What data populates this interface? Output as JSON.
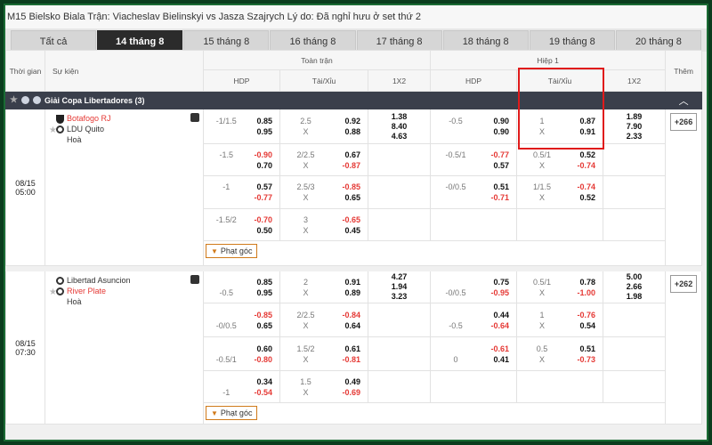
{
  "ticker": "M15 Bielsko Biala Trận: Viacheslav Bielinskyi vs Jasza Szajrych Lý do: Đã nghỉ hưu ở set thứ 2",
  "tabs": [
    "Tất cả",
    "14 tháng 8",
    "15 tháng 8",
    "16 tháng 8",
    "17 tháng 8",
    "18 tháng 8",
    "19 tháng 8",
    "20 tháng 8"
  ],
  "header": {
    "time": "Thời gian",
    "event": "Sự kiện",
    "full": "Toàn trận",
    "half": "Hiệp 1",
    "more": "Thêm",
    "hdp": "HDP",
    "ou": "Tài/Xỉu",
    "x12": "1X2"
  },
  "league": {
    "name": "Giải Copa Libertadores (3)",
    "collapse_icon": "chevron-up-icon"
  },
  "matches": [
    {
      "date": "08/15",
      "time": "05:00",
      "home": "Botafogo RJ",
      "away": "LDU Quito",
      "draw": "Hoà",
      "more": "+266",
      "corner": "Phạt góc",
      "rows": [
        {
          "hdp": [
            "-1/1.5",
            "",
            "0.85",
            "0.95"
          ],
          "ou": [
            "2.5",
            "X",
            "0.92",
            "0.88"
          ],
          "x12": [
            "1.38",
            "8.40",
            "4.63"
          ],
          "hhdp": [
            "-0.5",
            "",
            "0.90",
            "0.90"
          ],
          "hou": [
            "1",
            "X",
            "0.87",
            "0.91"
          ],
          "hx12": [
            "1.89",
            "7.90",
            "2.33"
          ]
        },
        {
          "hdp": [
            "-1.5",
            "",
            "-0.90",
            "0.70"
          ],
          "ou": [
            "2/2.5",
            "X",
            "0.67",
            "-0.87"
          ],
          "hhdp": [
            "-0.5/1",
            "",
            "-0.77",
            "0.57"
          ],
          "hou": [
            "0.5/1",
            "X",
            "0.52",
            "-0.74"
          ]
        },
        {
          "hdp": [
            "-1",
            "",
            "0.57",
            "-0.77"
          ],
          "ou": [
            "2.5/3",
            "X",
            "-0.85",
            "0.65"
          ],
          "hhdp": [
            "-0/0.5",
            "",
            "0.51",
            "-0.71"
          ],
          "hou": [
            "1/1.5",
            "X",
            "-0.74",
            "0.52"
          ]
        },
        {
          "hdp": [
            "-1.5/2",
            "",
            "-0.70",
            "0.50"
          ],
          "ou": [
            "3",
            "X",
            "-0.65",
            "0.45"
          ]
        }
      ]
    },
    {
      "date": "08/15",
      "time": "07:30",
      "home": "Libertad Asuncion",
      "away": "River Plate",
      "draw": "Hoà",
      "more": "+262",
      "corner": "Phạt góc",
      "rows": [
        {
          "hdp": [
            "",
            "-0.5",
            "0.85",
            "0.95"
          ],
          "ou": [
            "2",
            "X",
            "0.91",
            "0.89"
          ],
          "x12": [
            "4.27",
            "1.94",
            "3.23"
          ],
          "hhdp": [
            "",
            "-0/0.5",
            "0.75",
            "-0.95"
          ],
          "hou": [
            "0.5/1",
            "X",
            "0.78",
            "-1.00"
          ],
          "hx12": [
            "5.00",
            "2.66",
            "1.98"
          ]
        },
        {
          "hdp": [
            "",
            "-0/0.5",
            "-0.85",
            "0.65"
          ],
          "ou": [
            "2/2.5",
            "X",
            "-0.84",
            "0.64"
          ],
          "hhdp": [
            "",
            "-0.5",
            "0.44",
            "-0.64"
          ],
          "hou": [
            "1",
            "X",
            "-0.76",
            "0.54"
          ]
        },
        {
          "hdp": [
            "",
            "-0.5/1",
            "0.60",
            "-0.80"
          ],
          "ou": [
            "1.5/2",
            "X",
            "0.61",
            "-0.81"
          ],
          "hhdp": [
            "",
            "0",
            "-0.61",
            "0.41"
          ],
          "hou": [
            "0.5",
            "X",
            "0.51",
            "-0.73"
          ]
        },
        {
          "hdp": [
            "",
            "-1",
            "0.34",
            "-0.54"
          ],
          "ou": [
            "1.5",
            "X",
            "0.49",
            "-0.69"
          ]
        }
      ]
    }
  ]
}
